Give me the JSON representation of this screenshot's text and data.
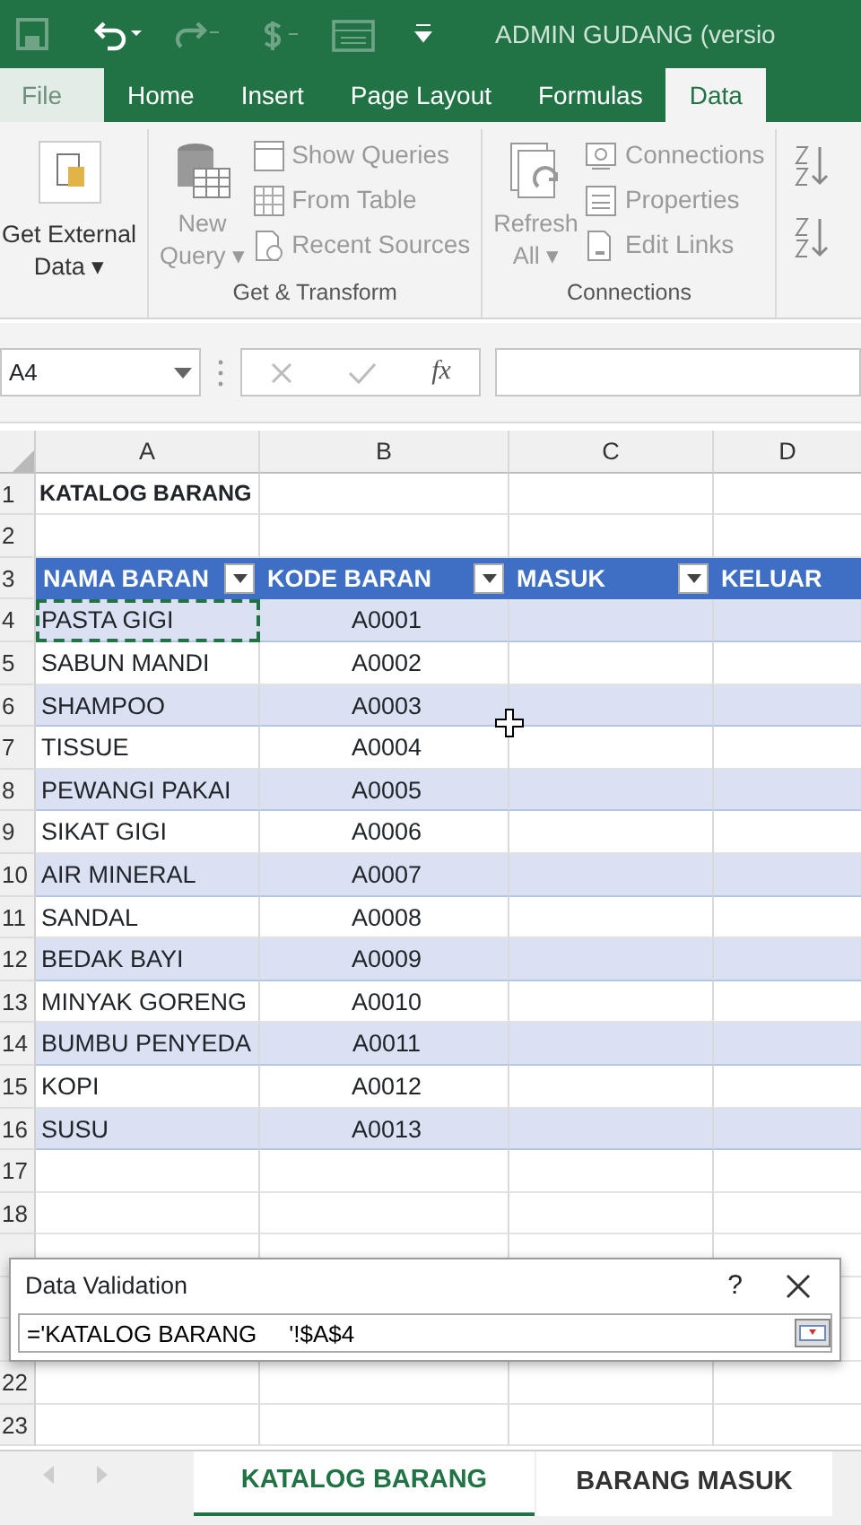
{
  "title_bar": {
    "title": "ADMIN GUDANG (versio",
    "quick_access": [
      {
        "kind": "save",
        "disabled": true
      },
      {
        "kind": "undo",
        "disabled": false
      },
      {
        "kind": "redo",
        "disabled": true
      },
      {
        "kind": "currency",
        "disabled": true
      },
      {
        "kind": "form",
        "disabled": true
      },
      {
        "kind": "customize",
        "disabled": false
      }
    ]
  },
  "ribbon_tabs": [
    {
      "label": "File",
      "selected": false,
      "faded": true
    },
    {
      "label": "Home",
      "selected": false,
      "faded": false
    },
    {
      "label": "Insert",
      "selected": false,
      "faded": false
    },
    {
      "label": "Page Layout",
      "selected": false,
      "faded": false
    },
    {
      "label": "Formulas",
      "selected": false,
      "faded": false
    },
    {
      "label": "Data",
      "selected": true,
      "faded": false
    }
  ],
  "ribbon": {
    "get_external": {
      "label_1": "Get External",
      "label_2": "Data",
      "caret": "▾"
    },
    "groups": [
      {
        "label": "Get & Transform",
        "big": {
          "kind": "query",
          "label_1": "New",
          "label_2": "Query",
          "caret": "▾",
          "disabled": true
        },
        "items": [
          {
            "kind": "queries",
            "label": "Show Queries",
            "disabled": true
          },
          {
            "kind": "table",
            "label": "From Table",
            "disabled": true
          },
          {
            "kind": "recent",
            "label": "Recent Sources",
            "disabled": true
          }
        ]
      },
      {
        "label": "Connections",
        "big": {
          "kind": "refresh",
          "label_1": "Refresh",
          "label_2": "All",
          "caret": "▾",
          "disabled": true
        },
        "items": [
          {
            "kind": "connections",
            "label": "Connections",
            "disabled": true
          },
          {
            "kind": "properties",
            "label": "Properties",
            "disabled": true
          },
          {
            "kind": "links",
            "label": "Edit Links",
            "disabled": true
          }
        ]
      }
    ]
  },
  "formula_bar": {
    "name_box": "A4",
    "fx": "fx"
  },
  "columns": [
    "A",
    "B",
    "C",
    "D"
  ],
  "rows": [
    {
      "number": "1",
      "kind": "title",
      "cells": [
        "KATALOG BARANG"
      ]
    },
    {
      "number": "2",
      "kind": "blank",
      "cells": []
    },
    {
      "number": "3",
      "kind": "header",
      "cells": [
        "NAMA BARAN",
        "KODE BARAN",
        "MASUK",
        "KELUAR"
      ],
      "filters": [
        true,
        true,
        true,
        false
      ]
    },
    {
      "number": "4",
      "kind": "data",
      "banded": true,
      "selected": true,
      "cells": [
        "PASTA GIGI",
        "A0001"
      ]
    },
    {
      "number": "5",
      "kind": "data",
      "banded": false,
      "selected": false,
      "cells": [
        "SABUN MANDI",
        "A0002"
      ]
    },
    {
      "number": "6",
      "kind": "data",
      "banded": true,
      "selected": false,
      "cells": [
        "SHAMPOO",
        "A0003"
      ]
    },
    {
      "number": "7",
      "kind": "data",
      "banded": false,
      "selected": false,
      "cells": [
        "TISSUE",
        "A0004"
      ]
    },
    {
      "number": "8",
      "kind": "data",
      "banded": true,
      "selected": false,
      "cells": [
        "PEWANGI PAKAI",
        "A0005"
      ]
    },
    {
      "number": "9",
      "kind": "data",
      "banded": false,
      "selected": false,
      "cells": [
        "SIKAT GIGI",
        "A0006"
      ]
    },
    {
      "number": "10",
      "kind": "data",
      "banded": true,
      "selected": false,
      "cells": [
        "AIR MINERAL",
        "A0007"
      ]
    },
    {
      "number": "11",
      "kind": "data",
      "banded": false,
      "selected": false,
      "cells": [
        "SANDAL",
        "A0008"
      ]
    },
    {
      "number": "12",
      "kind": "data",
      "banded": true,
      "selected": false,
      "cells": [
        "BEDAK BAYI",
        "A0009"
      ]
    },
    {
      "number": "13",
      "kind": "data",
      "banded": false,
      "selected": false,
      "cells": [
        "MINYAK GORENG",
        "A0010"
      ]
    },
    {
      "number": "14",
      "kind": "data",
      "banded": true,
      "selected": false,
      "cells": [
        "BUMBU PENYEDA",
        "A0011"
      ]
    },
    {
      "number": "15",
      "kind": "data",
      "banded": false,
      "selected": false,
      "cells": [
        "KOPI",
        "A0012"
      ]
    },
    {
      "number": "16",
      "kind": "data",
      "banded": true,
      "selected": false,
      "cells": [
        "SUSU",
        "A0013"
      ]
    },
    {
      "number": "17",
      "kind": "blank",
      "cells": []
    },
    {
      "number": "18",
      "kind": "blank",
      "cells": []
    },
    {
      "number": "22",
      "kind": "blank",
      "cells": []
    },
    {
      "number": "23",
      "kind": "blank",
      "cells": []
    }
  ],
  "dialog": {
    "title": "Data Validation",
    "help": "?",
    "value": "='KATALOG BARANG     '!$A$4"
  },
  "sheet_tabs": [
    {
      "label": "KATALOG BARANG",
      "selected": true
    },
    {
      "label": "BARANG MASUK",
      "selected": false
    }
  ]
}
